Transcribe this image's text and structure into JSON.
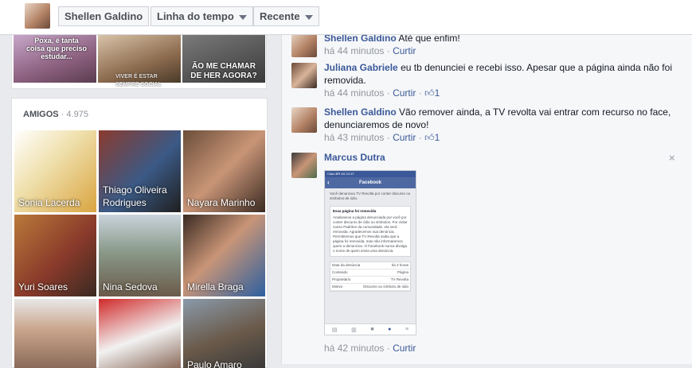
{
  "topbar": {
    "profile_name": "Shellen Galdino",
    "timeline_label": "Linha do tempo",
    "recent_label": "Recente"
  },
  "photos": [
    {
      "caption": "Poxa, é tanta coisa que preciso estudar..."
    },
    {
      "caption": "VIVER É ESTAR SEMPRE SOCIAL"
    },
    {
      "caption": "ÃO ME CHAMAR DE HER AGORA?"
    }
  ],
  "friends": {
    "heading": "AMIGOS",
    "count": "· 4.975",
    "tiles": [
      {
        "name": "Sonia Lacerda"
      },
      {
        "name": "Thiago Oliveira Rodrigues"
      },
      {
        "name": "Nayara Marinho"
      },
      {
        "name": "Yuri Soares"
      },
      {
        "name": "Nina Sedova"
      },
      {
        "name": "Mirella Braga"
      },
      {
        "name": ""
      },
      {
        "name": ""
      },
      {
        "name": "Paulo Amaro"
      }
    ]
  },
  "comments": [
    {
      "author": "Shellen Galdino",
      "text": "Até que enfim!",
      "time": "há 44 minutos",
      "like": "Curtir",
      "likes": ""
    },
    {
      "author": "Juliana Gabriele",
      "text": "eu tb denunciei e recebi isso. Apesar que a página ainda não foi removida.",
      "time": "há 44 minutos",
      "like": "Curtir",
      "likes": "1"
    },
    {
      "author": "Shellen Galdino",
      "text": "Vão remover ainda, a TV revolta vai entrar com recurso no face, denunciaremos de novo!",
      "time": "há 43 minutos",
      "like": "Curtir",
      "likes": "1"
    },
    {
      "author": "Marcus Dutra",
      "text": "",
      "time": "há 42 minutos",
      "like": "Curtir",
      "likes": ""
    }
  ],
  "screenshot": {
    "status": "Claro BR   4G   12:47",
    "title": "Facebook",
    "intro": "Você denunciou TV Revolta por conter discurso ou símbolos de ódio.",
    "box_title": "Essa página foi removida",
    "box_text": "Analisamos a página denunciada por você por conter discurso de ódio ou símbolos. Por violar nosso Padrões da comunidade, ela será removida. Agradecemos sua denúncia. Permitiremos que TV Revolta saiba que a página foi removida, mas não informaremos quem a denunciou. O Facebook nunca divulga o nome de quem envia uma denúncia.",
    "rows": [
      {
        "k": "Data da denúncia",
        "v": "há 3 horas"
      },
      {
        "k": "Conteúdo",
        "v": "Página"
      },
      {
        "k": "Proprietário",
        "v": "TV Revolta"
      },
      {
        "k": "Motivo",
        "v": "Discurso ou símbolo de ódio"
      }
    ]
  },
  "close_icon": "×",
  "like_icon": "thumbs-up-icon"
}
